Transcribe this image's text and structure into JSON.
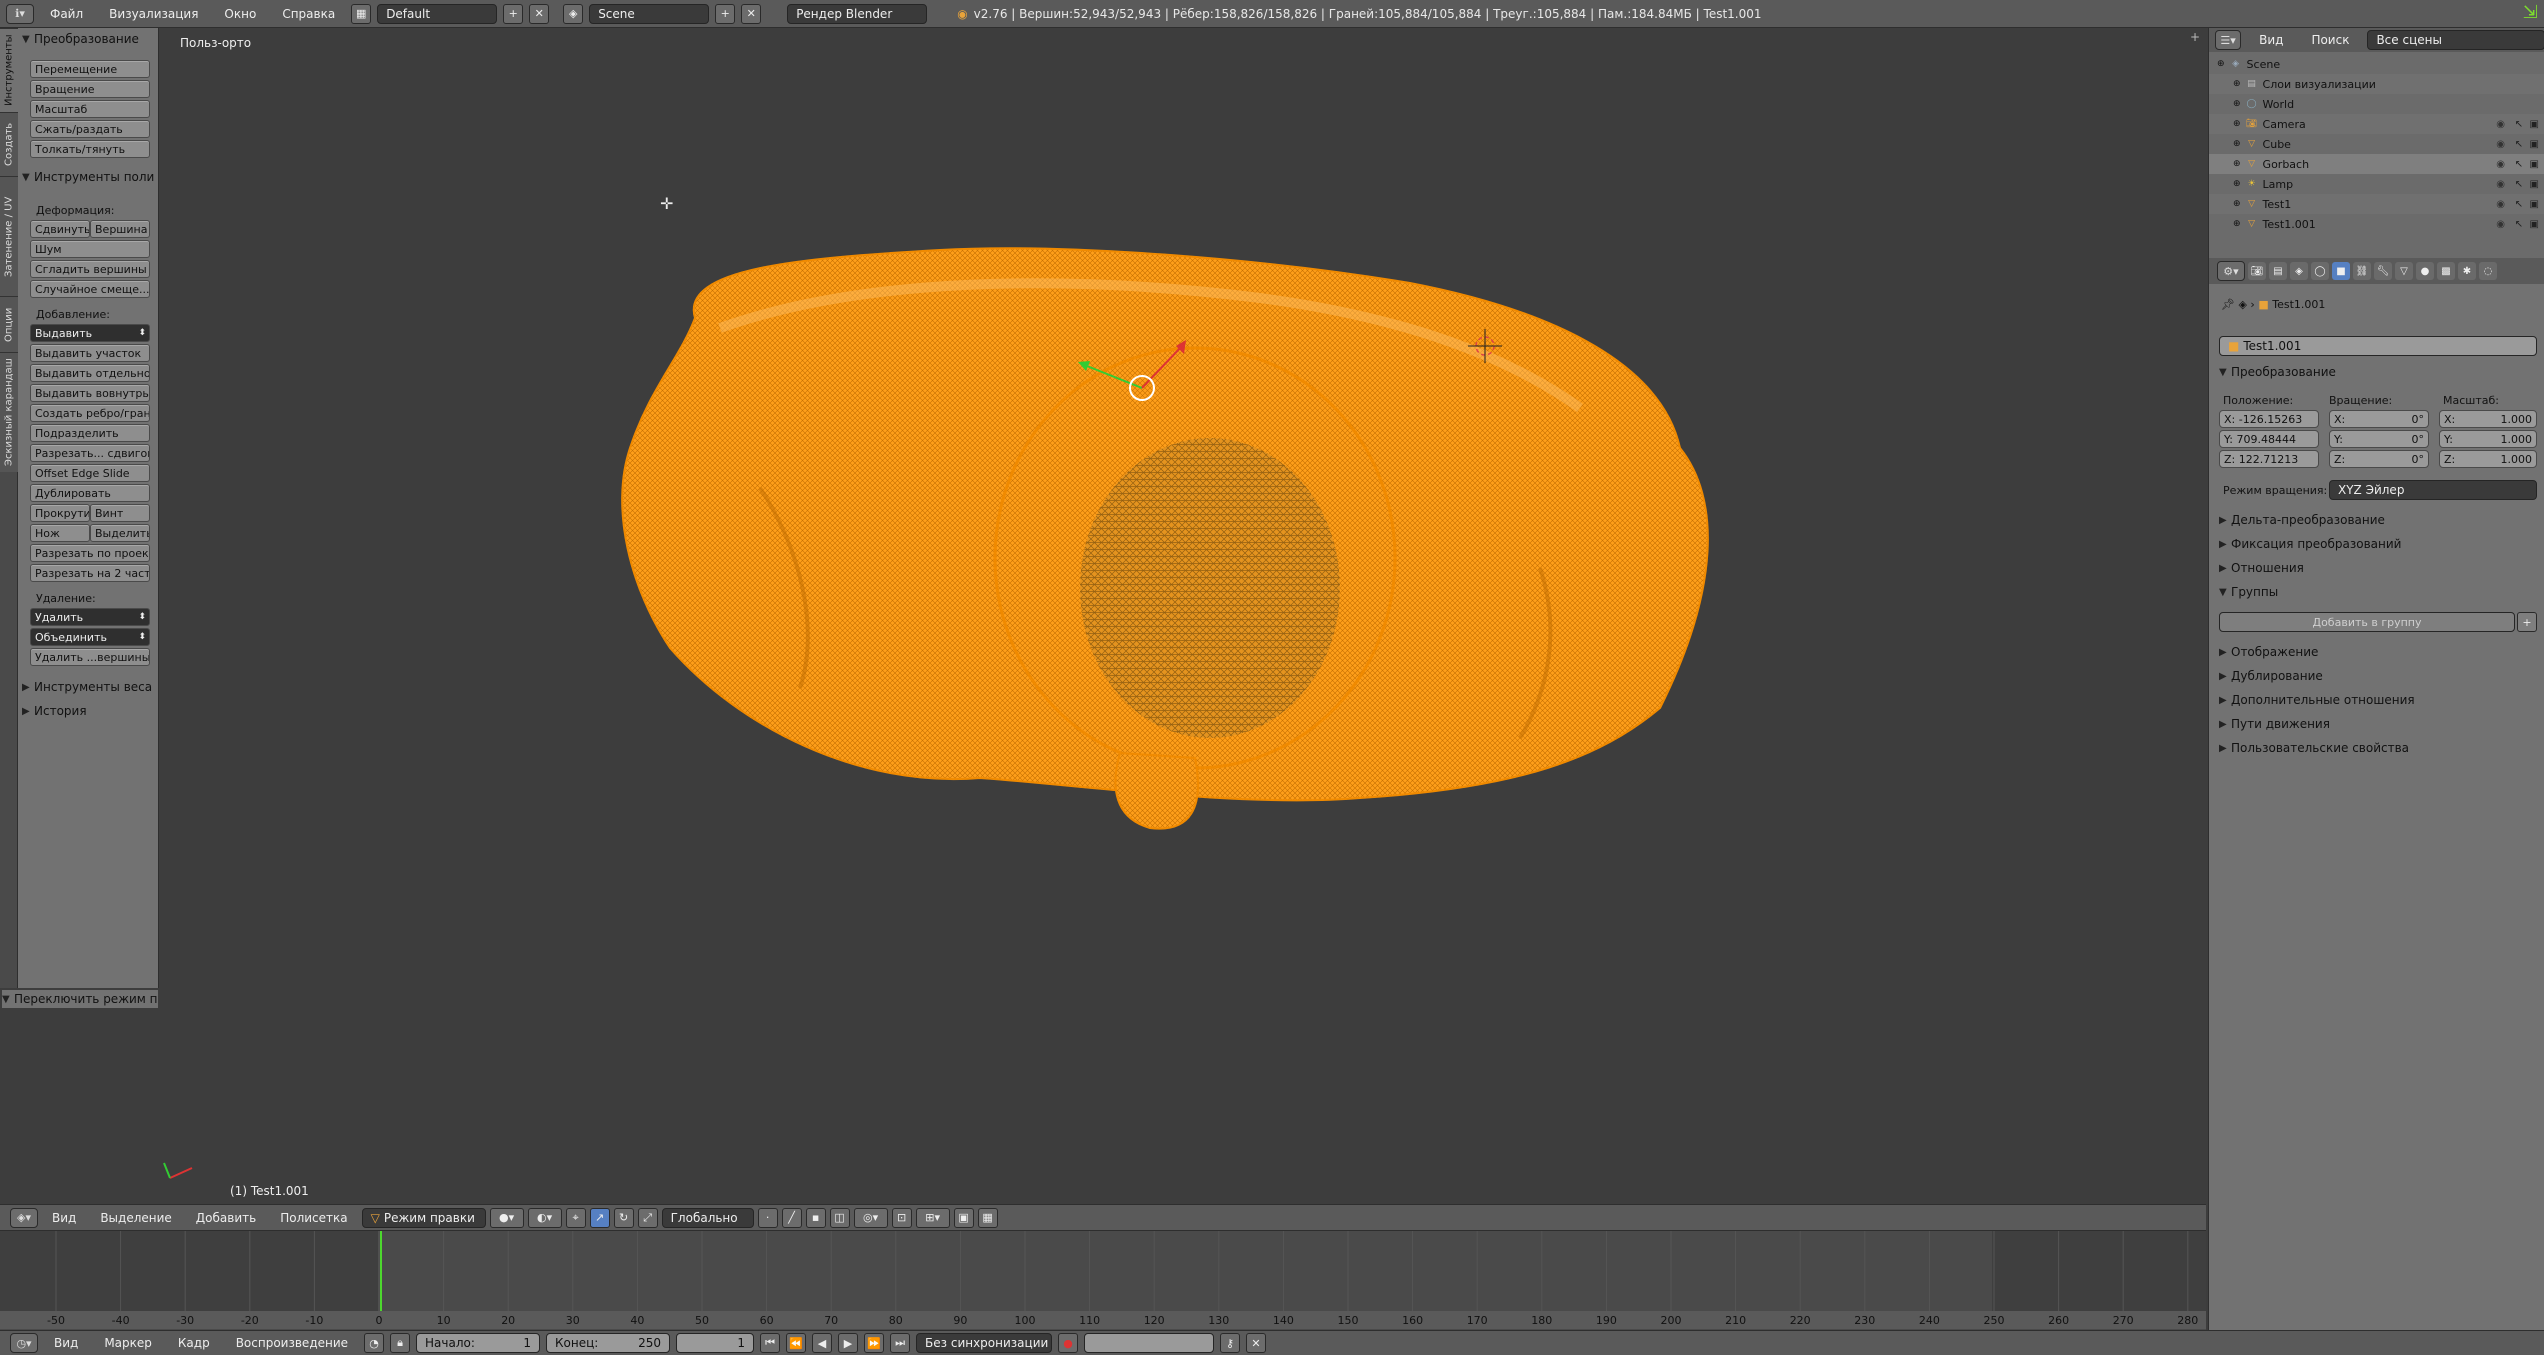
{
  "topbar": {
    "menus": [
      "Файл",
      "Визуализация",
      "Окно",
      "Справка"
    ],
    "layout_value": "Default",
    "scene_value": "Scene",
    "engine_value": "Рендер Blender",
    "stats": "v2.76 | Вершин:52,943/52,943 | Рёбер:158,826/158,826 | Граней:105,884/105,884 | Треуг.:105,884 | Пам.:184.84МБ | Test1.001"
  },
  "lefttabs": [
    "Инструменты",
    "Создать",
    "Затенение / UV",
    "Опции",
    "Эскизный карандаш"
  ],
  "toolshelf": {
    "transform_header": "Преобразование",
    "transform_buttons": [
      "Перемещение",
      "Вращение",
      "Масштаб",
      "Сжать/раздать",
      "Толкать/тянуть"
    ],
    "mesh_tools_header": "Инструменты поли",
    "deform_label": "Деформация:",
    "deform_slide": "Сдвинуть",
    "deform_vertex": "Вершина",
    "deform_buttons": [
      "Шум",
      "Сгладить вершины",
      "Случайное смеще..."
    ],
    "add_label": "Добавление:",
    "extrude_dropdown": "Выдавить",
    "add_buttons": [
      "Выдавить участок",
      "Выдавить отдельно",
      "Выдавить вовнутрь",
      "Создать ребро/грань",
      "Подразделить",
      "Разрезать... сдвигом",
      "Offset Edge Slide",
      "Дублировать"
    ],
    "spin": "Прокрути",
    "screw": "Винт",
    "knife": "Нож",
    "select": "Выделить",
    "bisect": "Разрезать по проек...",
    "split2": "Разрезать на 2 части",
    "delete_label": "Удаление:",
    "delete_dropdown": "Удалить",
    "merge_dropdown": "Объединить",
    "delete_edge": "Удалить ...вершины",
    "weight_header": "Инструменты веса",
    "history_header": "История",
    "toggle_mode": "Переключить режим п"
  },
  "viewport": {
    "view_name": "Польз-орто",
    "object_label": "(1) Test1.001"
  },
  "vhdr": {
    "menus": [
      "Вид",
      "Выделение",
      "Добавить",
      "Полисетка"
    ],
    "mode": "Режим правки",
    "orientation": "Глобально"
  },
  "timeline": {
    "ticks": [
      "-50",
      "-40",
      "-30",
      "-20",
      "-10",
      "0",
      "10",
      "20",
      "30",
      "40",
      "50",
      "60",
      "70",
      "80",
      "90",
      "100",
      "110",
      "120",
      "130",
      "140",
      "150",
      "160",
      "170",
      "180",
      "190",
      "200",
      "210",
      "220",
      "230",
      "240",
      "250",
      "260",
      "270",
      "280"
    ],
    "current_frame_value": 0
  },
  "tl_footer": {
    "menus": [
      "Вид",
      "Маркер",
      "Кадр",
      "Воспроизведение"
    ],
    "start": "Начало:",
    "start_value": "1",
    "end": "Конец:",
    "end_value": "250",
    "current": "1",
    "sync": "Без синхронизации"
  },
  "outliner": {
    "menus": [
      "Вид",
      "Поиск"
    ],
    "filter": "Все сцены",
    "rows": [
      {
        "label": "Scene",
        "icon": "scene-icon",
        "indent": 0
      },
      {
        "label": "Слои визуализации",
        "icon": "render-layers-icon",
        "indent": 1
      },
      {
        "label": "World",
        "icon": "world-icon",
        "indent": 1
      },
      {
        "label": "Camera",
        "icon": "camera-icon",
        "indent": 1
      },
      {
        "label": "Cube",
        "icon": "mesh-icon",
        "indent": 1
      },
      {
        "label": "Gorbach",
        "icon": "mesh-icon",
        "indent": 1
      },
      {
        "label": "Lamp",
        "icon": "lamp-icon",
        "indent": 1
      },
      {
        "label": "Test1",
        "icon": "mesh-icon",
        "indent": 1
      },
      {
        "label": "Test1.001",
        "icon": "mesh-icon",
        "indent": 1
      }
    ]
  },
  "props": {
    "breadcrumb": "Test1.001",
    "object_name": "Test1.001",
    "transform": "Преобразование",
    "loc_label": "Положение:",
    "rot_label": "Вращение:",
    "scale_label": "Масштаб:",
    "loc": [
      "X: -126.15263",
      "Y: 709.48444",
      "Z: 122.71213"
    ],
    "rot_axes": [
      "X:",
      "Y:",
      "Z:"
    ],
    "rot_vals": [
      "0°",
      "0°",
      "0°"
    ],
    "scale_axes": [
      "X:",
      "Y:",
      "Z:"
    ],
    "scale_vals": [
      "1.000",
      "1.000",
      "1.000"
    ],
    "rotmode_label": "Режим вращения:",
    "rotmode": "XYZ Эйлер",
    "sections": [
      "Дельта-преобразование",
      "Фиксация преобразований",
      "Отношения"
    ],
    "groups": "Группы",
    "add_to_group": "Добавить в группу",
    "sections2": [
      "Отображение",
      "Дублирование",
      "Дополнительные отношения",
      "Пути движения",
      "Пользовательские свойства"
    ]
  },
  "colors": {
    "mesh": "#ff9f1a",
    "mesh_dark": "#f08a00",
    "bg": "#3d3d3d"
  }
}
